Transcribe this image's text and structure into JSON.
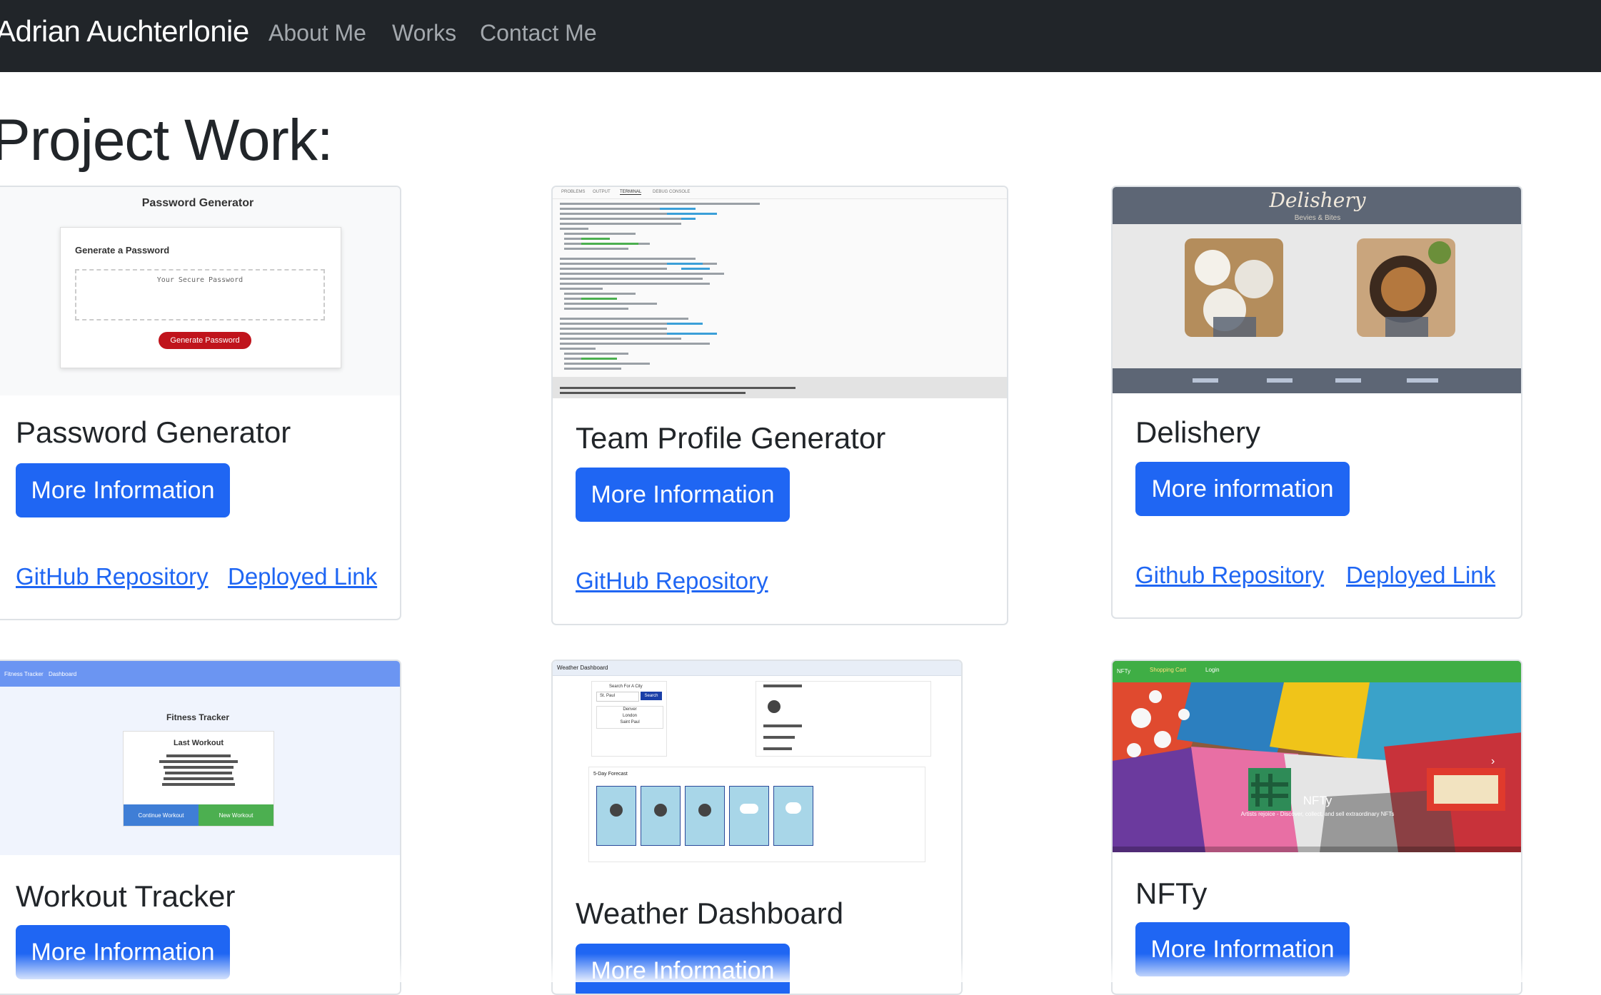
{
  "navbar": {
    "brand": "Adrian Auchterlonie",
    "links": [
      "About Me",
      "Works",
      "Contact Me"
    ]
  },
  "page": {
    "title": "Project Work:"
  },
  "projects": [
    {
      "title": "Password Generator",
      "button": "More Information",
      "links": [
        "GitHub Repository",
        "Deployed Link"
      ],
      "thumb": {
        "heading": "Password Generator",
        "subheading": "Generate a Password",
        "placeholder": "Your Secure Password",
        "button": "Generate Password"
      }
    },
    {
      "title": "Team Profile Generator",
      "button": "More Information",
      "links": [
        "GitHub Repository"
      ],
      "thumb": {
        "tabs": [
          "PROBLEMS",
          "OUTPUT",
          "TERMINAL",
          "DEBUG CONSOLE"
        ]
      }
    },
    {
      "title": "Delishery",
      "button": "More information",
      "links": [
        "Github Repository",
        "Deployed Link"
      ],
      "thumb": {
        "logo": "Delishery",
        "tagline": "Bevies & Bites"
      }
    },
    {
      "title": "Workout Tracker",
      "button": "More Information",
      "links": [],
      "thumb": {
        "nav": [
          "Fitness Tracker",
          "Dashboard"
        ],
        "heading": "Fitness Tracker",
        "panel_title": "Last Workout",
        "btn_continue": "Continue Workout",
        "btn_new": "New Workout"
      }
    },
    {
      "title": "Weather Dashboard",
      "button": "More Information",
      "links": [],
      "thumb": {
        "header": "Weather Dashboard",
        "search_label": "Search For A City",
        "search_btn": "Search",
        "city_input": "St. Paul",
        "cities": [
          "Denver",
          "London",
          "Saint Paul"
        ],
        "forecast_label": "5-Day Forecast"
      }
    },
    {
      "title": "NFTy",
      "button": "More Information",
      "links": [],
      "thumb": {
        "nav": [
          "NFTy",
          "Shopping Cart",
          "Login"
        ],
        "hero_title": "NFTy",
        "hero_sub": "Artists rejoice - Discover, collect, and sell extraordinary NFTs"
      }
    }
  ],
  "colors": {
    "navbar": "#212529",
    "primary": "#1f66f3",
    "link": "#1f66f3"
  }
}
